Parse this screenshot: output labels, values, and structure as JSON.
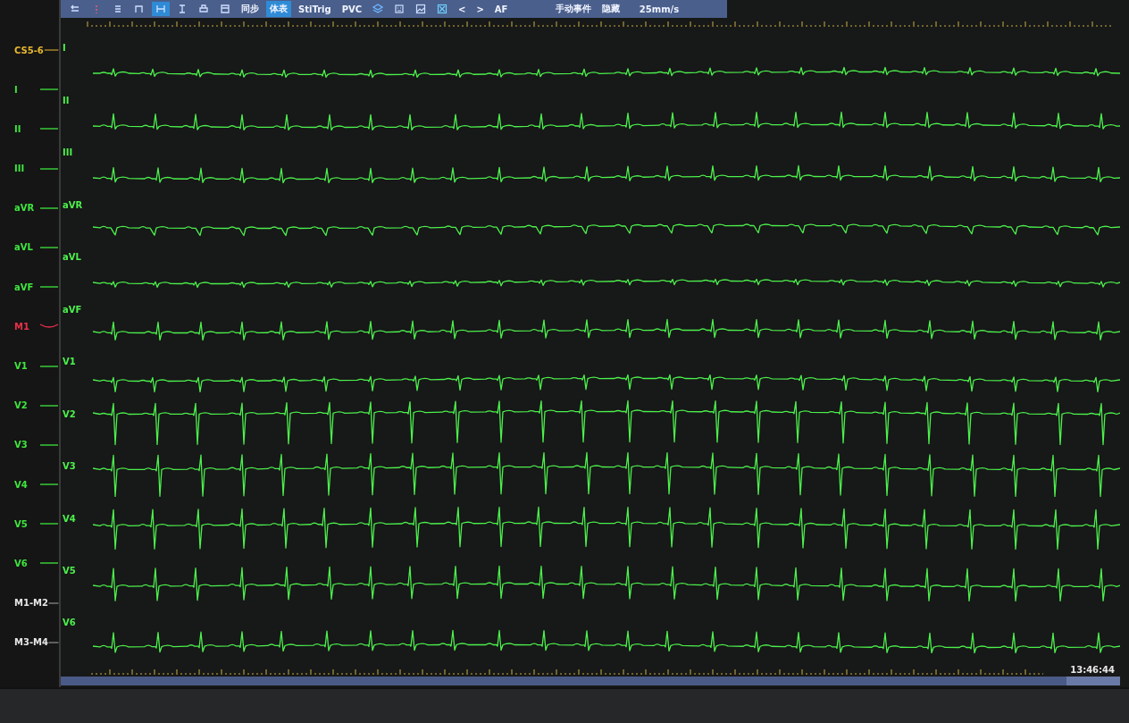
{
  "toolbar": {
    "icon_tools": [
      {
        "selected": false
      },
      {
        "selected": false
      },
      {
        "selected": false
      },
      {
        "selected": false
      },
      {
        "selected": true
      },
      {
        "selected": false
      },
      {
        "selected": false
      },
      {
        "selected": false
      }
    ],
    "view_buttons": [
      {
        "label": "同步",
        "selected": false
      },
      {
        "label": "体表",
        "selected": true
      },
      {
        "label": "StiTrig",
        "selected": false
      },
      {
        "label": "PVC",
        "selected": false
      }
    ],
    "nav_buttons": [
      "<",
      ">"
    ],
    "filter": "AF",
    "event_button": "手动事件",
    "hide_button": "隐藏",
    "speed": "25mm/s"
  },
  "channel_list": [
    {
      "name": "CS5-6",
      "color": "#e8b830"
    },
    {
      "name": "I",
      "color": "#3ee63e"
    },
    {
      "name": "II",
      "color": "#3ee63e"
    },
    {
      "name": "III",
      "color": "#3ee63e"
    },
    {
      "name": "aVR",
      "color": "#3ee63e"
    },
    {
      "name": "aVL",
      "color": "#3ee63e"
    },
    {
      "name": "aVF",
      "color": "#3ee63e"
    },
    {
      "name": "M1",
      "color": "#e8304a"
    },
    {
      "name": "V1",
      "color": "#3ee63e"
    },
    {
      "name": "V2",
      "color": "#3ee63e"
    },
    {
      "name": "V3",
      "color": "#3ee63e"
    },
    {
      "name": "V4",
      "color": "#3ee63e"
    },
    {
      "name": "V5",
      "color": "#3ee63e"
    },
    {
      "name": "V6",
      "color": "#3ee63e"
    },
    {
      "name": "M1-M2",
      "color": "#e6e6e6"
    },
    {
      "name": "M3-M4",
      "color": "#e6e6e6"
    }
  ],
  "traces": [
    {
      "lead": "I"
    },
    {
      "lead": "II"
    },
    {
      "lead": "III"
    },
    {
      "lead": "aVR"
    },
    {
      "lead": "aVL"
    },
    {
      "lead": "aVF"
    },
    {
      "lead": "V1"
    },
    {
      "lead": "V2"
    },
    {
      "lead": "V3"
    },
    {
      "lead": "V4"
    },
    {
      "lead": "V5"
    },
    {
      "lead": "V6"
    }
  ],
  "time": "13:46:44"
}
